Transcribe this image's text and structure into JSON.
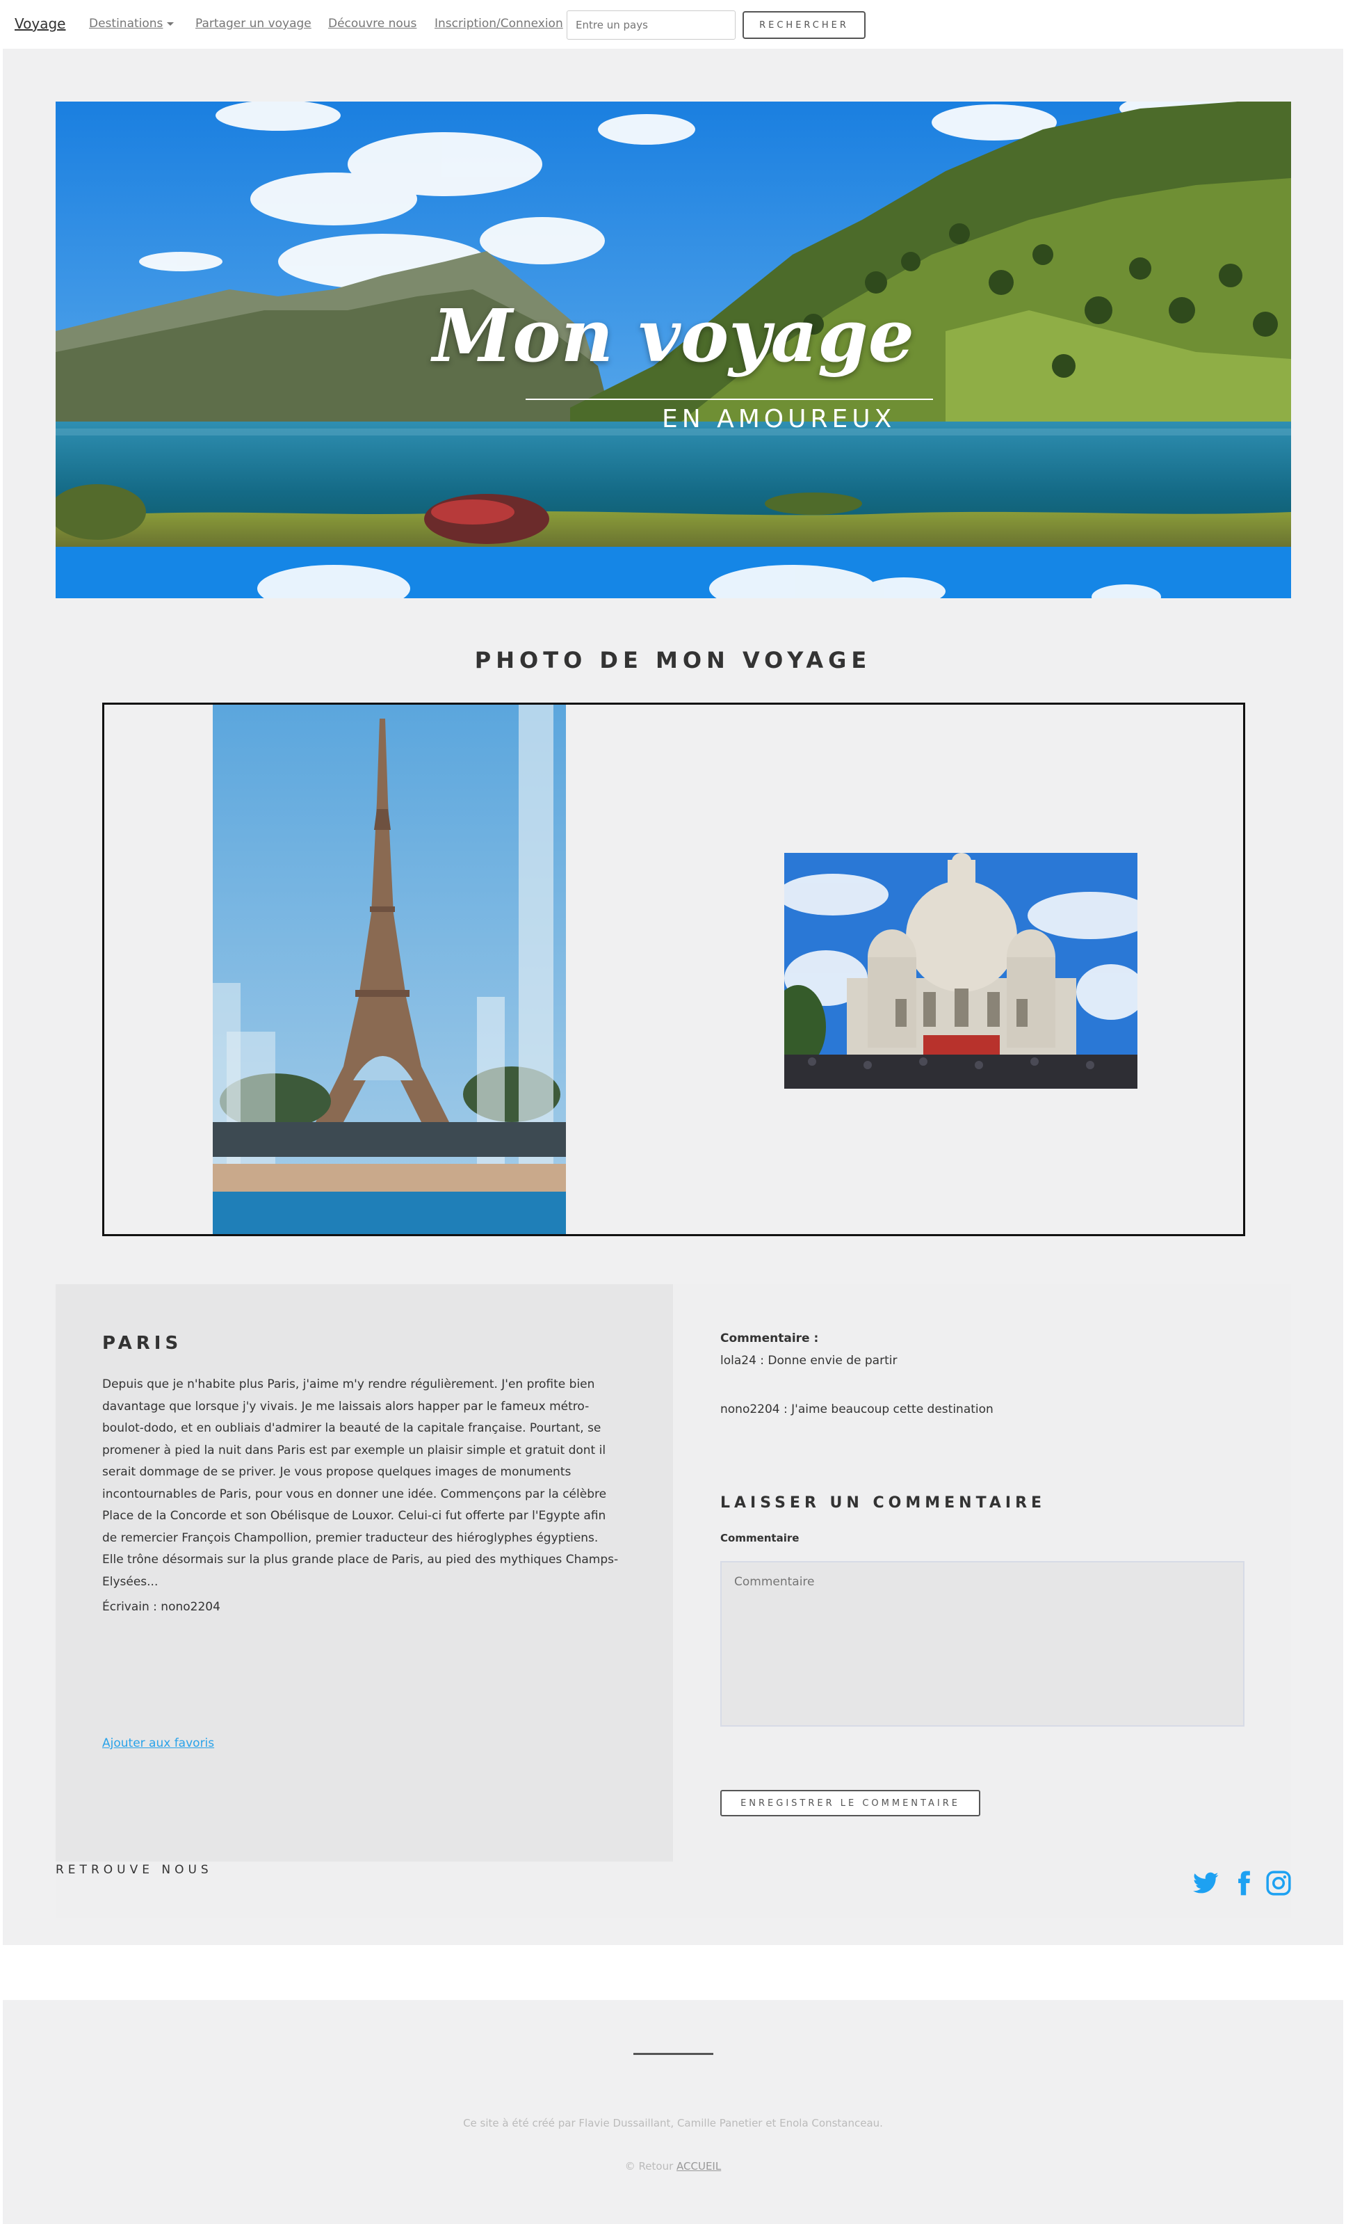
{
  "navbar": {
    "brand": "Voyage",
    "links": {
      "destinations": "Destinations",
      "share": "Partager un voyage",
      "discover": "Découvre nous",
      "login": "Inscription/Connexion"
    },
    "search_placeholder": "Entre un pays",
    "search_button": "RECHERCHER"
  },
  "hero": {
    "title": "Mon voyage",
    "subtitle": "EN AMOUREUX"
  },
  "gallery": {
    "title": "PHOTO DE MON VOYAGE"
  },
  "article": {
    "city": "PARIS",
    "text": "Depuis que je n'habite plus Paris, j'aime m'y rendre régulièrement. J'en profite bien davantage que lorsque j'y vivais. Je me laissais alors happer par le fameux métro-boulot-dodo, et en oubliais d'admirer la beauté de la capitale française. Pourtant, se promener à pied la nuit dans Paris est par exemple un plaisir simple et gratuit dont il serait dommage de se priver. Je vous propose quelques images de monuments incontournables de Paris, pour vous en donner une idée. Commençons par la célèbre Place de la Concorde et son Obélisque de Louxor. Celui-ci fut offerte par l'Egypte afin de remercier François Champollion, premier traducteur des hiéroglyphes égyptiens. Elle trône désormais sur la plus grande place de Paris, au pied des mythiques Champs-Elysées...",
    "writer": "Écrivain : nono2204",
    "favorite_link": "Ajouter aux favoris"
  },
  "comments": {
    "label": "Commentaire :",
    "items": [
      "lola24 : Donne envie de partir",
      "nono2204 : J'aime beaucoup cette destination"
    ],
    "form_title": "LAISSER UN COMMENTAIRE",
    "field_label": "Commentaire",
    "placeholder": "Commentaire",
    "submit": "ENREGISTRER LE COMMENTAIRE"
  },
  "social": {
    "label": "RETROUVE NOUS",
    "accent": "#1da1f2"
  },
  "footer": {
    "credits": "Ce site à été créé par Flavie Dussaillant, Camille Panetier et Enola Constanceau.",
    "copyright_prefix": "© Retour",
    "home_link": "ACCUEIL"
  }
}
